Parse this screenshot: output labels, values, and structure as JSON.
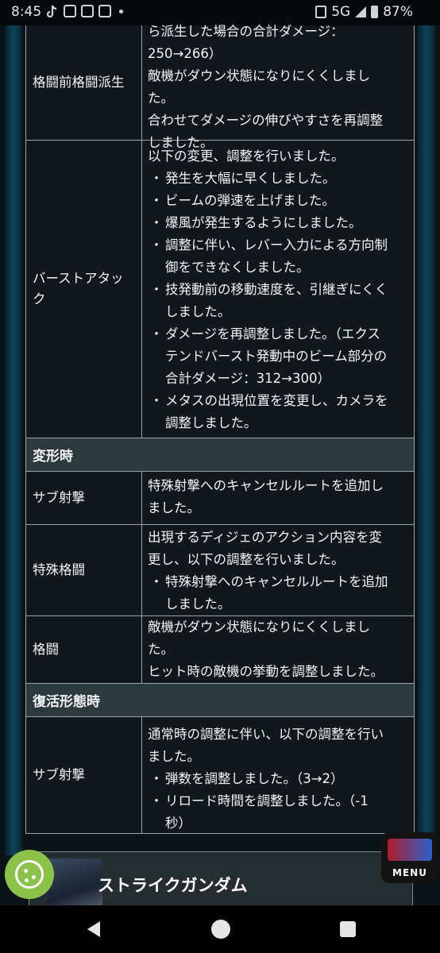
{
  "status_bar": {
    "time": "8:45",
    "network": "5G",
    "battery": "87%"
  },
  "table": {
    "rows_top": [
      {
        "name": "格闘前格闘派生",
        "lines": [
          "ら派生した場合の合計ダメージ：",
          "250→266）",
          "敵機がダウン状態になりにくくしまし",
          "た。",
          "合わせてダメージの伸びやすさを再調整",
          "しました。"
        ]
      },
      {
        "name_lines": [
          "バーストアタッ",
          "ク"
        ],
        "intro": "以下の変更、調整を行いました。",
        "bullets": [
          [
            "発生を大幅に早くしました。"
          ],
          [
            "ビームの弾速を上げました。"
          ],
          [
            "爆風が発生するようにしました。"
          ],
          [
            "調整に伴い、レバー入力による方向制",
            "御をできなくしました。"
          ],
          [
            "技発動前の移動速度を、引継ぎにくく",
            "しました。"
          ],
          [
            "ダメージを再調整しました。（エクス",
            "テンドバースト発動中のビーム部分の",
            "合計ダメージ：312→300）"
          ],
          [
            "メタスの出現位置を変更し、カメラを",
            "調整しました。"
          ]
        ]
      }
    ],
    "section_transform": "変形時",
    "transform_rows": [
      {
        "name": "サブ射撃",
        "lines": [
          "特殊射撃へのキャンセルルートを追加し",
          "ました。"
        ]
      },
      {
        "name": "特殊格闘",
        "lines": [
          "出現するディジェのアクション内容を変",
          "更し、以下の調整を行いました。"
        ],
        "bullets": [
          [
            "特殊射撃へのキャンセルルートを追加",
            "しました。"
          ]
        ]
      },
      {
        "name": "格闘",
        "lines": [
          "敵機がダウン状態になりにくくしまし",
          "た。",
          "ヒット時の敵機の挙動を調整しました。"
        ]
      }
    ],
    "section_revival": "復活形態時",
    "revival_rows": [
      {
        "name": "サブ射撃",
        "lines": [
          "通常時の調整に伴い、以下の調整を行い",
          "ました。"
        ],
        "bullets": [
          [
            "弾数を調整しました。（3→2）"
          ],
          [
            "リロード時間を調整しました。（-1",
            "秒）"
          ]
        ]
      }
    ]
  },
  "bullet_mark": "・",
  "card": {
    "title": "ストライクガンダム"
  },
  "menu_badge": {
    "label": "MENU"
  },
  "colors": {
    "page_bg": "#0a1418",
    "section_header_bg": "#2c393d",
    "cookie_green": "#8bc34a"
  }
}
